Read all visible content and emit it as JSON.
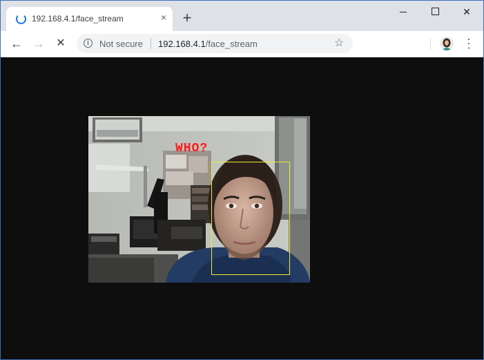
{
  "tab": {
    "title": "192.168.4.1/face_stream",
    "close_symbol": "×"
  },
  "new_tab_symbol": "+",
  "window_controls": {
    "close_symbol": "✕"
  },
  "nav": {
    "back_symbol": "←",
    "forward_symbol": "→",
    "stop_symbol": "✕"
  },
  "omnibox": {
    "security_text": "Not secure",
    "url_host": "192.168.4.1",
    "url_path": "/face_stream",
    "info_symbol": "i",
    "star_symbol": "☆"
  },
  "menu_symbol": "⋮",
  "stream": {
    "detection_label": "WHO?"
  },
  "colors": {
    "page_bg": "#0e0e0e",
    "loading_spinner": "#1a73e8",
    "detection_label": "#ff1a1a",
    "face_box": "#ecec2e"
  }
}
